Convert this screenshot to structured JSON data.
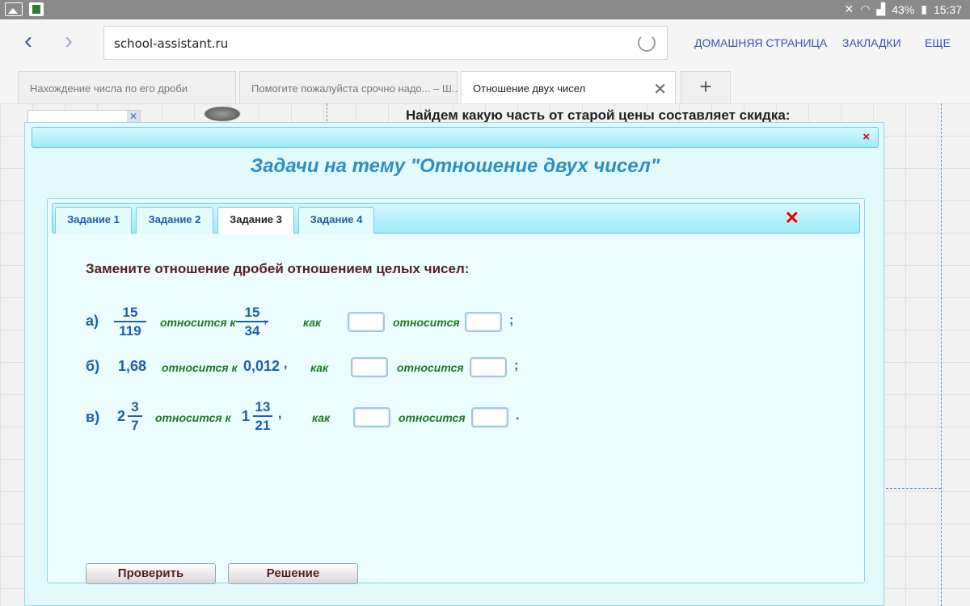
{
  "status_bar": {
    "battery": "43%",
    "time": "15:37"
  },
  "browser": {
    "url": "school-assistant.ru",
    "menu": {
      "home": "ДОМАШНЯЯ СТРАНИЦА",
      "bookmarks": "ЗАКЛАДКИ",
      "more": "ЕЩЕ"
    },
    "tabs": [
      {
        "label": "Нахождение числа по его дроби"
      },
      {
        "label": "Помогите пожалуйста срочно надо... – Ш..."
      },
      {
        "label": "Отношение двух чисел"
      }
    ],
    "new_tab": "+"
  },
  "page": {
    "heading": "Найдем какую часть от старой цены составляет скидка:"
  },
  "modal": {
    "title": "Задачи на тему \"Отношение двух чисел\"",
    "close": "×",
    "tabs": [
      {
        "label": "Задание 1"
      },
      {
        "label": "Задание 2"
      },
      {
        "label": "Задание 3"
      },
      {
        "label": "Задание 4"
      }
    ],
    "tab_close": "✕",
    "instruction": "Замените отношение дробей отношением целых чисел:",
    "words": {
      "relates_to": "относится к",
      "as": "как",
      "relates": "относится"
    },
    "rows": [
      {
        "label": "а)",
        "left": {
          "num": "15",
          "den": "119"
        },
        "right": {
          "num": "15",
          "den": "34"
        },
        "sep": ",",
        "end": ";"
      },
      {
        "label": "б)",
        "left": "1,68",
        "right": "0,012",
        "sep": ",",
        "end": ";"
      },
      {
        "label": "в)",
        "left": {
          "whole": "2",
          "num": "3",
          "den": "7"
        },
        "right": {
          "whole": "1",
          "num": "13",
          "den": "21"
        },
        "sep": ",",
        "end": "."
      }
    ],
    "buttons": {
      "check": "Проверить",
      "solution": "Решение"
    }
  }
}
